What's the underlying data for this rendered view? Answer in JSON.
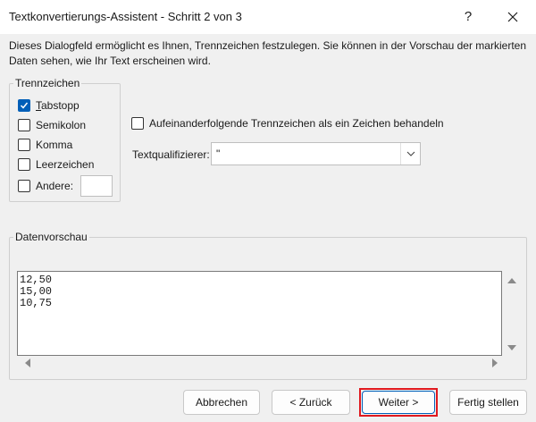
{
  "window": {
    "title": "Textkonvertierungs-Assistent - Schritt 2 von 3",
    "help_label": "?",
    "close_icon": "close-icon"
  },
  "description": "Dieses Dialogfeld ermöglicht es Ihnen, Trennzeichen festzulegen. Sie können in der Vorschau der markierten Daten sehen, wie Ihr Text erscheinen wird.",
  "delimiters": {
    "group_label": "Trennzeichen",
    "options": [
      {
        "label": "Tabstopp",
        "checked": true
      },
      {
        "label": "Semikolon",
        "checked": false
      },
      {
        "label": "Komma",
        "checked": false
      },
      {
        "label": "Leerzeichen",
        "checked": false
      },
      {
        "label": "Andere:",
        "checked": false
      }
    ],
    "other_value": ""
  },
  "consecutive": {
    "label": "Aufeinanderfolgende Trennzeichen als ein Zeichen behandeln",
    "checked": false
  },
  "qualifier": {
    "label": "Textqualifizierer:",
    "value": "\""
  },
  "preview": {
    "group_label": "Datenvorschau",
    "lines": [
      "12,50",
      "15,00",
      "10,75"
    ]
  },
  "buttons": {
    "cancel": "Abbrechen",
    "back": "< Zurück",
    "next": "Weiter >",
    "finish": "Fertig stellen"
  },
  "colors": {
    "accent": "#005fb8",
    "highlight": "#e0191f"
  }
}
